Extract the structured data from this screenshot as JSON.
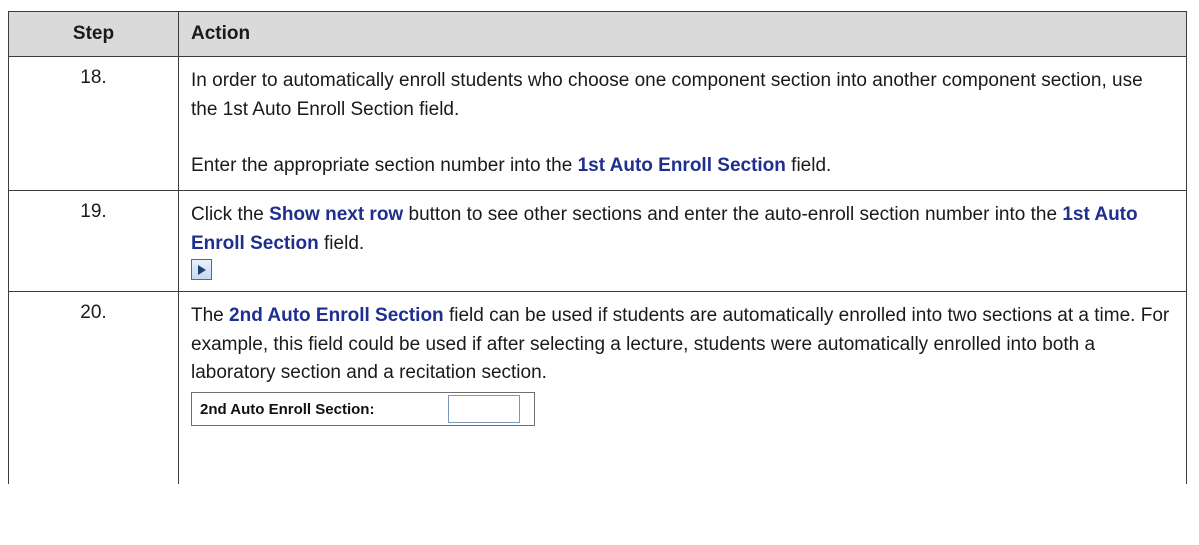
{
  "table": {
    "headers": {
      "step": "Step",
      "action": "Action"
    },
    "rows": [
      {
        "step": "18.",
        "p1": "In order to automatically enroll students who choose one component section into another component section, use the 1st Auto Enroll Section field.",
        "p2_before": "Enter the appropriate section number into the ",
        "p2_field": "1st Auto Enroll Section",
        "p2_after": " field."
      },
      {
        "step": "19.",
        "t1": "Click the ",
        "button_name": "Show next row",
        "t2": " button to see other sections and enter the auto-enroll section number into the ",
        "field": "1st Auto Enroll Section",
        "t3": " field.",
        "icon": "show-next-row-arrow"
      },
      {
        "step": "20.",
        "field": "2nd Auto Enroll Section",
        "text": " field can be used if students are automatically enrolled into two sections at a time.  For example, this field could be used if after selecting a lecture, students were automatically enrolled into both a laboratory section and a recitation section.",
        "the": "The ",
        "screenshot_label": "2nd Auto Enroll Section:",
        "screenshot_value": ""
      }
    ]
  },
  "colors": {
    "header_bg": "#dadada",
    "highlight": "#1f2f8f",
    "border": "#3c3c3c"
  }
}
